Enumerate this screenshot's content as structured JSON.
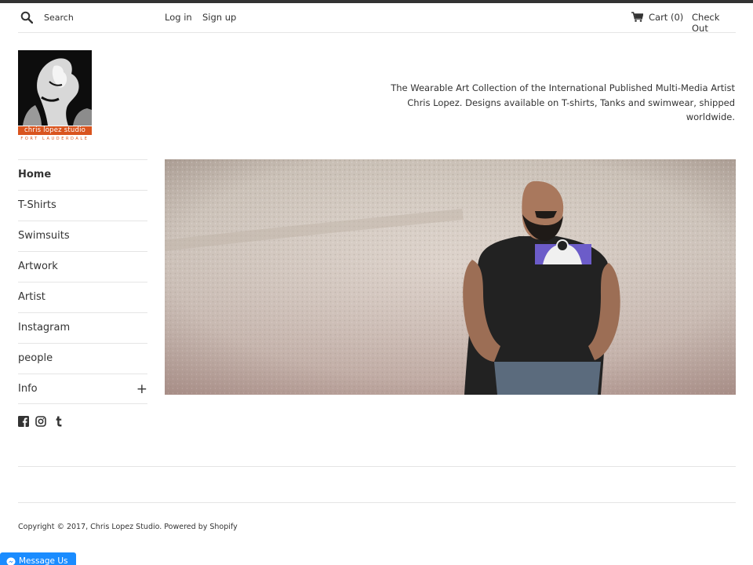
{
  "header": {
    "search_placeholder": "Search",
    "login_label": "Log in",
    "signup_label": "Sign up",
    "cart_label": "Cart (0)",
    "checkout_label": "Check Out"
  },
  "logo": {
    "name": "chris lopez studio",
    "city": "FORT LAUDERDALE"
  },
  "tagline": "The Wearable Art Collection of the International Published Multi-Media Artist Chris Lopez. Designs available on T-shirts, Tanks and swimwear, shipped worldwide.",
  "nav": {
    "items": [
      {
        "label": "Home"
      },
      {
        "label": "T-Shirts"
      },
      {
        "label": "Swimsuits"
      },
      {
        "label": "Artwork"
      },
      {
        "label": "Artist"
      },
      {
        "label": "Instagram"
      },
      {
        "label": "people"
      },
      {
        "label": "Info"
      }
    ],
    "expand_symbol": "+"
  },
  "social": [
    "facebook-icon",
    "instagram-icon",
    "tumblr-icon"
  ],
  "footer": {
    "copyright": "Copyright © 2017, Chris Lopez Studio. Powered by Shopify"
  },
  "messenger": {
    "label": "Message Us"
  },
  "colors": {
    "accent": "#d9541e",
    "text": "#333333",
    "messenger": "#1a8cff"
  }
}
